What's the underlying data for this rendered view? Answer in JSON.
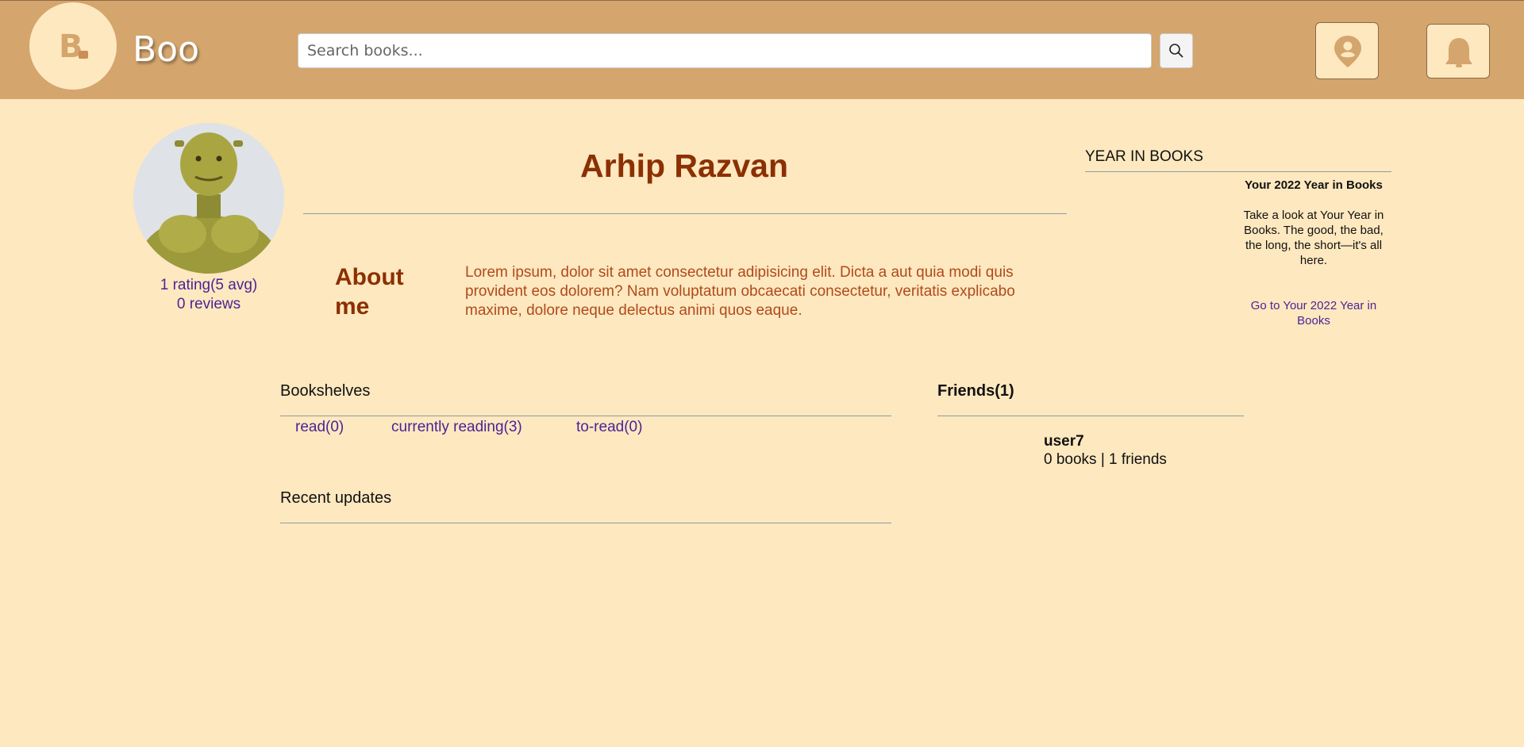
{
  "header": {
    "logo_letter": "B",
    "brand": "Boo",
    "search_placeholder": "Search books...",
    "icons": {
      "search": "search-icon",
      "location": "location-user-icon",
      "notifications": "bell-icon"
    },
    "colors": {
      "bar": "#d4a56d",
      "page": "#fee8bf"
    }
  },
  "profile": {
    "name": "Arhip Razvan",
    "rating_text": "1 rating(5 avg)",
    "reviews_text": "0 reviews",
    "about_title": "About me",
    "about_text": "Lorem ipsum, dolor sit amet consectetur adipisicing elit. Dicta a aut quia modi quis provident eos dolorem? Nam voluptatum obcaecati consectetur, veritatis explicabo maxime, dolore neque delectus animi quos eaque."
  },
  "year_in_books": {
    "title": "YEAR IN BOOKS",
    "heading": "Your 2022 Year in Books",
    "description": "Take a look at Your Year in Books. The good, the bad, the long, the short—it's all here.",
    "link": "Go to Your 2022 Year in Books"
  },
  "bookshelves": {
    "title": "Bookshelves",
    "shelves": [
      {
        "label": "read(0)"
      },
      {
        "label": "currently reading(3)"
      },
      {
        "label": "to-read(0)"
      }
    ]
  },
  "recent_updates": {
    "title": "Recent updates"
  },
  "friends": {
    "title": "Friends(1)",
    "items": [
      {
        "name": "user7",
        "stats": "0 books | 1 friends"
      }
    ]
  }
}
